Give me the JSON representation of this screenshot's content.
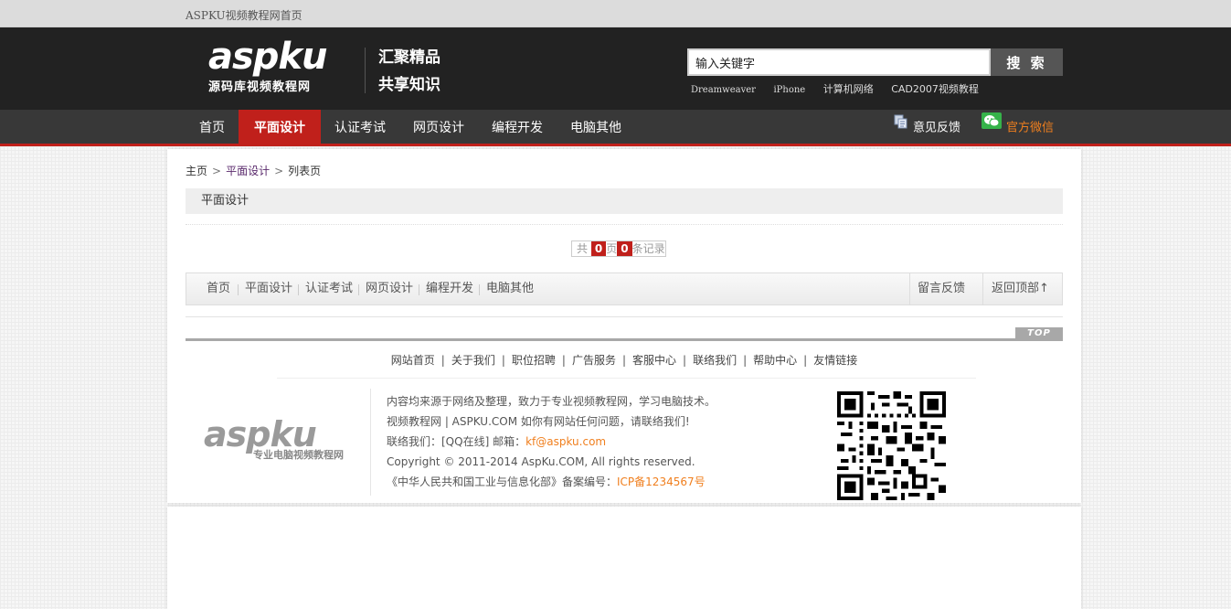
{
  "topbar": {
    "home_link": "ASPKU视频教程网首页"
  },
  "header": {
    "logo_text": "aspku",
    "logo_sub": "源码库视频教程网",
    "slogan_line1": "汇聚精品",
    "slogan_line2": "共享知识",
    "search": {
      "value": "输入关键字",
      "button": "搜 索"
    },
    "hotwords": [
      "Dreamweaver",
      "iPhone",
      "计算机网络",
      "CAD2007视频教程"
    ]
  },
  "nav": {
    "items": [
      "首页",
      "平面设计",
      "认证考试",
      "网页设计",
      "编程开发",
      "电脑其他"
    ],
    "active_index": 1,
    "feedback": "意见反馈",
    "wechat": "官方微信"
  },
  "breadcrumb": {
    "home": "主页",
    "category": "平面设计",
    "current": "列表页"
  },
  "category_title": "平面设计",
  "pager": {
    "prefix": "共",
    "pages": "0",
    "page_unit": "页",
    "records": "0",
    "record_unit": "条记录"
  },
  "footer_nav": {
    "items": [
      "首页",
      "平面设计",
      "认证考试",
      "网页设计",
      "编程开发",
      "电脑其他"
    ],
    "feedback": "留言反馈",
    "back_top": "返回顶部↑"
  },
  "top_button": "TOP",
  "footer_links": [
    "网站首页",
    "关于我们",
    "职位招聘",
    "广告服务",
    "客服中心",
    "联络我们",
    "帮助中心",
    "友情链接"
  ],
  "footer_logo": {
    "word": "aspku",
    "sub": "专业电脑视频教程网"
  },
  "footer_info": {
    "line1": "内容均来源于网络及整理，致力于专业视频教程网，学习电脑技术。",
    "line2": "视频教程网 | ASPKU.COM   如你有网站任何问题，请联络我们!",
    "line3_prefix": "联络我们：[QQ在线]  邮箱：",
    "email": "kf@aspku.com",
    "line4": "Copyright © 2011-2014 AspKu.COM, All rights reserved.",
    "line5_prefix": "《中华人民共和国工业与信息化部》备案编号：",
    "icp": "ICP备1234567号"
  },
  "colors": {
    "accent_red": "#c0201b",
    "header_bg": "#222222",
    "nav_bg": "#383838",
    "orange": "#f07f1e"
  },
  "icons": [
    "feedback-icon",
    "wechat-icon",
    "qr-code"
  ]
}
